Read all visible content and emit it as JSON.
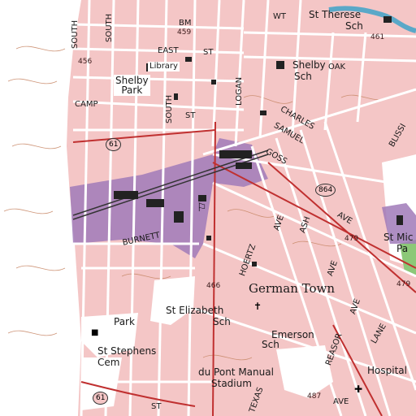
{
  "labels": {
    "shelby_park": "Shelby\nPark",
    "library": "Library",
    "bm": "BM",
    "bm_elev": "459",
    "wt": "WT",
    "st_therese": "St Therese",
    "st_therese_sch": "Sch",
    "shelby_sch": "Shelby",
    "shelby_sch2": "Sch",
    "oak": "OAK",
    "camp": "CAMP",
    "east": "EAST",
    "st1": "ST",
    "st2": "ST",
    "south1": "SOUTH",
    "south2": "SOUTH",
    "south3": "SOUTH",
    "logan": "LOGAN",
    "charles": "CHARLES",
    "samuel": "SAMUEL",
    "goss": "GOSS",
    "burnett": "BURNETT",
    "ash": "ASH",
    "ave1": "AVE",
    "ave2": "AVE",
    "ave3": "AVE",
    "ave4": "AVE",
    "ave5": "AVE",
    "st_mich": "St Mic",
    "pa": "Pa",
    "german_town": "German Town",
    "st_elizabeth": "St Elizabeth",
    "st_eliz_sch": "Sch",
    "emerson": "Emerson",
    "emerson_sch": "Sch",
    "st_stephens": "St Stephens",
    "cem": "Cem",
    "park": "Park",
    "dupont": "du Pont Manual",
    "stadium": "Stadium",
    "hospital": "Hospital",
    "reasor": "REASOR",
    "hoertz": "HOERTZ",
    "texas": "TEXAS",
    "lane": "LANE",
    "bl": "ST",
    "el456": "456",
    "el461": "461",
    "el479": "479",
    "el466": "466",
    "el487": "487",
    "el479b": "479",
    "route61a": "61",
    "route61b": "61",
    "route864": "864",
    "blissi": "BLISSI"
  },
  "colors": {
    "urban_tint": "#f4c6c6",
    "street": "#ffffff",
    "street_edge": "#c03030",
    "industrial": "#a07ab8",
    "contour": "#c98a6a",
    "water": "#5aa8c8",
    "park_green": "#8cc878"
  }
}
